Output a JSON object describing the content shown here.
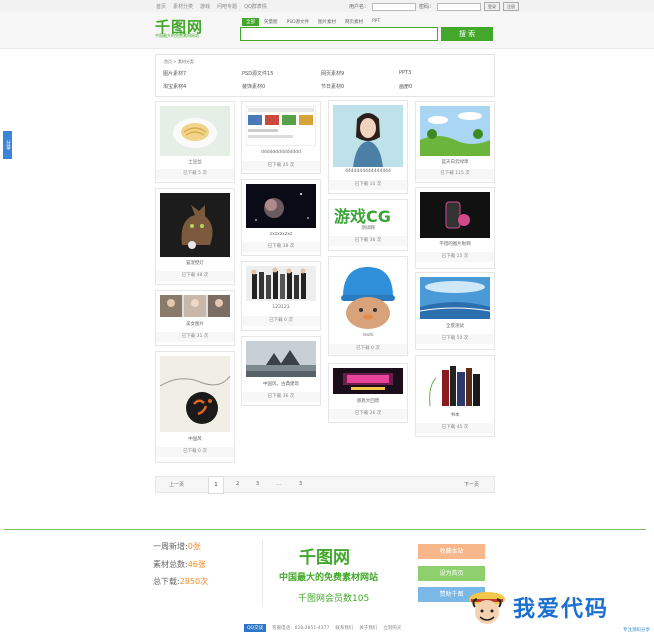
{
  "topnav": [
    "首页",
    "素材分类",
    "游戏",
    "问吧专题",
    "QQ群表情"
  ],
  "login": {
    "user_label": "用户名：",
    "pass_label": "密码：",
    "login_btn": "登录",
    "reg_btn": "注册"
  },
  "header": {
    "logo": "千图网",
    "slogan": "中国最大的免费素材网站"
  },
  "search": {
    "tabs": [
      "全部",
      "矢量图",
      "PSD源文件",
      "图片素材",
      "网页素材",
      "PPT"
    ],
    "button": "搜 索"
  },
  "sidetab": "分享",
  "categories": {
    "crumb": "首页 > 素材分类",
    "items": [
      "图片素材7",
      "PSD源文件15",
      "网页素材9",
      "PPT3",
      "淘宝素材4",
      "装饰素材0",
      "节日素材0",
      "画册0"
    ]
  },
  "cards": [
    {
      "title": "土豆丝",
      "downloads": "已下载 5 次"
    },
    {
      "title": "dddddddddddddd",
      "downloads": "已下载 25 次"
    },
    {
      "title": "4444444444444444",
      "downloads": "已下载 10 次"
    },
    {
      "title": "蓝天白云绿草",
      "downloads": "已下载 115 次"
    },
    {
      "title": "猫宠壁灯",
      "downloads": "已下载 48 次"
    },
    {
      "title": "zxzxzxzxz",
      "downloads": "已下载 38 次"
    },
    {
      "title": "游戏CG",
      "subtitle": "测试啊",
      "downloads": "已下载 36 次"
    },
    {
      "title": "不错的图片啦啊",
      "downloads": "已下载 15 次"
    },
    {
      "title": "美女图片",
      "downloads": "已下载 31 次"
    },
    {
      "title": "123123",
      "downloads": "已下载 0 次"
    },
    {
      "title": "reshi",
      "downloads": "已下载 0 次"
    },
    {
      "title": "全景测试",
      "downloads": "已下载 50 次"
    },
    {
      "title": "中国风",
      "downloads": "已下载 0 次"
    },
    {
      "title": "中国风，古典建筑",
      "downloads": "已下载 36 次"
    },
    {
      "title": "感恩大回馈",
      "downloads": "已下载 26 次"
    },
    {
      "title": "书本",
      "downloads": "已下载 45 次"
    }
  ],
  "game_banner": "游戏CG",
  "pager": {
    "prev": "上一页",
    "pages": [
      "1",
      "2",
      "3",
      "…",
      "3"
    ],
    "next": "下一页"
  },
  "footer": {
    "week_label": "一周新增:",
    "week_val": "0张",
    "total_label": "素材总数:",
    "total_val": "46张",
    "dl_label": "总下载:",
    "dl_val": "2850次",
    "logo": "千图网",
    "slogan": "中国最大的免费素材网站",
    "members": "千图网会员数105",
    "btns": [
      "收藏本站",
      "设为首页",
      "赞助千图"
    ]
  },
  "bottom": {
    "qq": "QQ交谈",
    "phone": "客服电话：028-2851-4377",
    "about": "联系我们",
    "help": "关于我们",
    "more": "立刻购买"
  },
  "watermark": {
    "text": "我爱代码",
    "sub": "专注源码分享"
  },
  "colors": {
    "brand": "#43a72b",
    "accent": "#f58c26",
    "link": "#3a86d6"
  }
}
